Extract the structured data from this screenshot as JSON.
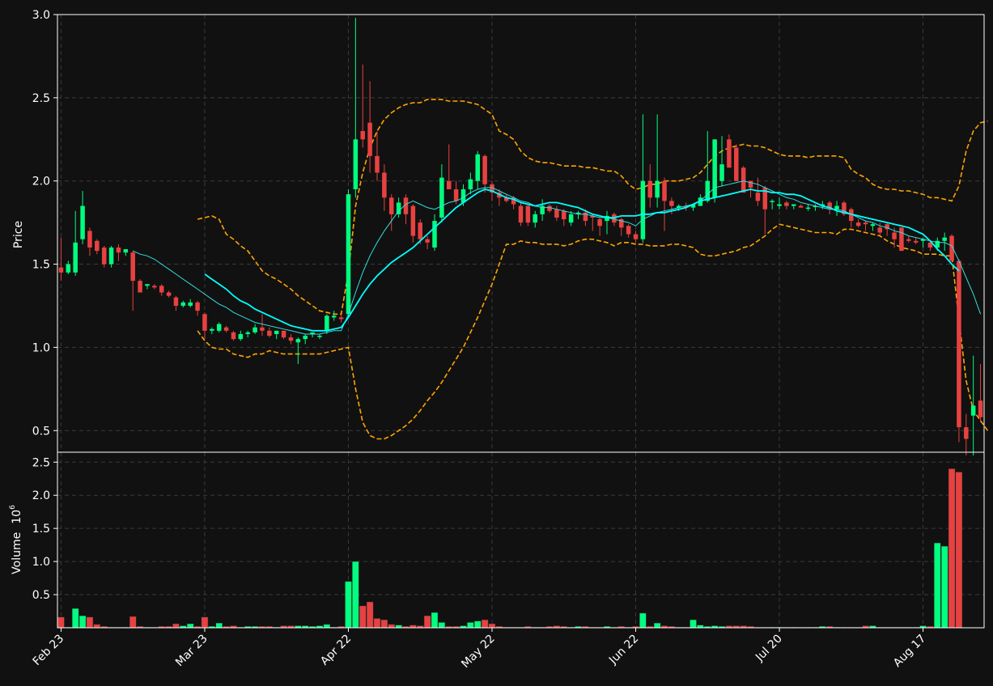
{
  "chart_data": [
    {
      "type": "candlestick",
      "panel": "price",
      "ylabel": "Price",
      "ylim": [
        0.37,
        3.0
      ],
      "yticks": [
        "0.5",
        "1.0",
        "1.5",
        "2.0",
        "2.5",
        "3.0"
      ],
      "grid": true,
      "x": [
        "Feb 23",
        "Feb 24",
        "Feb 25",
        "Feb 26",
        "Feb 27",
        "Feb 28",
        "Mar 1",
        "Mar 2",
        "Mar 3",
        "Mar 4",
        "Mar 5",
        "Mar 6",
        "Mar 7",
        "Mar 8",
        "Mar 9",
        "Mar 10",
        "Mar 11",
        "Mar 12",
        "Mar 13",
        "Mar 14",
        "Mar 23",
        "Mar 24",
        "Mar 25",
        "Mar 26",
        "Mar 27",
        "Mar 28",
        "Mar 29",
        "Mar 30",
        "Mar 31",
        "Apr 1",
        "Apr 2",
        "Apr 3",
        "Apr 4",
        "Apr 5",
        "Apr 6",
        "Apr 7",
        "Apr 8",
        "Apr 9",
        "Apr 10",
        "Apr 11",
        "Apr 22",
        "Apr 23",
        "Apr 24",
        "Apr 25",
        "Apr 26",
        "Apr 27",
        "Apr 28",
        "Apr 29",
        "Apr 30",
        "May 1",
        "May 2",
        "May 3",
        "May 4",
        "May 5",
        "May 6",
        "May 7",
        "May 8",
        "May 9",
        "May 10",
        "May 11",
        "May 22",
        "May 23",
        "May 24",
        "May 25",
        "May 26",
        "May 27",
        "May 28",
        "May 29",
        "May 30",
        "May 31",
        "Jun 1",
        "Jun 2",
        "Jun 3",
        "Jun 4",
        "Jun 5",
        "Jun 6",
        "Jun 7",
        "Jun 8",
        "Jun 9",
        "Jun 10",
        "Jun 22",
        "Jun 23",
        "Jun 24",
        "Jun 25",
        "Jun 26",
        "Jun 27",
        "Jun 28",
        "Jun 29",
        "Jun 30",
        "Jul 1",
        "Jul 2",
        "Jul 3",
        "Jul 4",
        "Jul 5",
        "Jul 6",
        "Jul 7",
        "Jul 8",
        "Jul 9",
        "Jul 10",
        "Jul 11",
        "Jul 20",
        "Jul 21",
        "Jul 22",
        "Jul 23",
        "Jul 24",
        "Jul 25",
        "Jul 26",
        "Jul 27",
        "Jul 28",
        "Jul 29",
        "Jul 30",
        "Jul 31",
        "Aug 1",
        "Aug 2",
        "Aug 3",
        "Aug 4",
        "Aug 5",
        "Aug 6",
        "Aug 7",
        "Aug 8",
        "Aug 17",
        "Aug 18",
        "Aug 19",
        "Aug 20",
        "Aug 21"
      ],
      "xticks": [
        {
          "index": 0,
          "label": "Feb 23"
        },
        {
          "index": 20,
          "label": "Mar 23"
        },
        {
          "index": 40,
          "label": "Apr 22"
        },
        {
          "index": 60,
          "label": "May 22"
        },
        {
          "index": 80,
          "label": "Jun 22"
        },
        {
          "index": 100,
          "label": "Jul 20"
        },
        {
          "index": 120,
          "label": "Aug 17"
        }
      ],
      "open": [
        1.48,
        1.45,
        1.45,
        1.65,
        1.7,
        1.64,
        1.6,
        1.5,
        1.6,
        1.57,
        1.57,
        1.4,
        1.37,
        1.37,
        1.37,
        1.33,
        1.3,
        1.25,
        1.25,
        1.27,
        1.2,
        1.1,
        1.1,
        1.12,
        1.09,
        1.05,
        1.08,
        1.09,
        1.12,
        1.1,
        1.08,
        1.1,
        1.06,
        1.03,
        1.05,
        1.08,
        1.07,
        1.1,
        1.18,
        1.18,
        1.2,
        1.95,
        2.3,
        2.35,
        2.15,
        2.05,
        1.9,
        1.8,
        1.9,
        1.85,
        1.75,
        1.65,
        1.6,
        1.78,
        2.0,
        1.95,
        1.87,
        1.95,
        2.0,
        2.15,
        1.98,
        1.93,
        1.9,
        1.9,
        1.85,
        1.85,
        1.75,
        1.8,
        1.85,
        1.83,
        1.82,
        1.75,
        1.8,
        1.81,
        1.79,
        1.77,
        1.76,
        1.8,
        1.77,
        1.73,
        1.68,
        1.65,
        2.0,
        1.9,
        2.0,
        1.88,
        1.84,
        1.85,
        1.84,
        1.85,
        1.88,
        1.9,
        2.0,
        2.25,
        2.2,
        2.08,
        2.0,
        1.93,
        1.96,
        1.88,
        1.85,
        1.87,
        1.85,
        1.85,
        1.84,
        1.85,
        1.85,
        1.87,
        1.83,
        1.87,
        1.83,
        1.75,
        1.75,
        1.73,
        1.72,
        1.74,
        1.69,
        1.72,
        1.65,
        1.64,
        1.64,
        1.63,
        1.6,
        1.64,
        1.67,
        1.52,
        0.52,
        0.59,
        0.68
      ],
      "high": [
        1.66,
        1.52,
        1.82,
        1.94,
        1.72,
        1.65,
        1.61,
        1.61,
        1.62,
        1.59,
        1.58,
        1.41,
        1.38,
        1.38,
        1.38,
        1.34,
        1.31,
        1.28,
        1.29,
        1.28,
        1.21,
        1.12,
        1.15,
        1.13,
        1.1,
        1.1,
        1.1,
        1.14,
        1.2,
        1.12,
        1.1,
        1.1,
        1.08,
        1.06,
        1.08,
        1.09,
        1.08,
        1.2,
        1.22,
        1.2,
        1.95,
        2.98,
        2.7,
        2.6,
        2.3,
        2.1,
        1.92,
        1.9,
        1.92,
        1.86,
        1.77,
        1.67,
        1.8,
        2.1,
        2.22,
        2.0,
        1.98,
        2.05,
        2.18,
        2.16,
        2.0,
        1.95,
        1.92,
        1.91,
        1.87,
        1.86,
        1.82,
        1.89,
        1.86,
        1.85,
        1.83,
        1.82,
        1.82,
        1.83,
        1.8,
        1.78,
        1.82,
        1.81,
        1.78,
        1.74,
        1.7,
        2.4,
        2.1,
        2.4,
        2.02,
        1.9,
        1.86,
        1.87,
        1.86,
        1.92,
        2.3,
        2.05,
        2.27,
        2.28,
        2.22,
        2.09,
        2.0,
        2.02,
        1.97,
        1.89,
        1.9,
        1.88,
        1.86,
        1.86,
        1.86,
        1.86,
        1.88,
        1.88,
        1.88,
        1.88,
        1.84,
        1.77,
        1.76,
        1.75,
        1.75,
        1.75,
        1.72,
        1.72,
        1.67,
        1.66,
        1.66,
        1.64,
        1.66,
        1.69,
        1.68,
        1.53,
        0.6,
        0.95,
        0.9
      ],
      "low": [
        1.4,
        1.44,
        1.43,
        1.62,
        1.55,
        1.56,
        1.48,
        1.48,
        1.52,
        1.55,
        1.22,
        1.34,
        1.35,
        1.35,
        1.31,
        1.3,
        1.22,
        1.24,
        1.24,
        1.19,
        1.05,
        1.08,
        1.09,
        1.09,
        1.04,
        1.04,
        1.06,
        1.08,
        1.07,
        1.06,
        1.05,
        1.05,
        1.02,
        0.9,
        1.02,
        1.06,
        1.05,
        1.08,
        1.16,
        1.15,
        1.18,
        1.9,
        2.2,
        2.05,
        2.0,
        1.82,
        1.7,
        1.78,
        1.74,
        1.63,
        1.62,
        1.59,
        1.58,
        1.75,
        1.95,
        1.86,
        1.85,
        1.92,
        1.95,
        1.93,
        1.88,
        1.85,
        1.87,
        1.83,
        1.73,
        1.73,
        1.72,
        1.76,
        1.81,
        1.76,
        1.73,
        1.73,
        1.77,
        1.73,
        1.7,
        1.67,
        1.68,
        1.73,
        1.67,
        1.66,
        1.63,
        1.63,
        1.84,
        1.84,
        1.7,
        1.8,
        1.82,
        1.82,
        1.82,
        1.85,
        1.87,
        1.87,
        1.97,
        2.15,
        2.08,
        1.97,
        1.9,
        1.85,
        1.68,
        1.83,
        1.83,
        1.83,
        1.83,
        1.84,
        1.82,
        1.82,
        1.83,
        1.8,
        1.79,
        1.79,
        1.72,
        1.72,
        1.7,
        1.7,
        1.67,
        1.67,
        1.6,
        1.6,
        1.63,
        1.62,
        1.6,
        1.58,
        1.58,
        1.58,
        1.6,
        0.43,
        0.35,
        0.35,
        0.55
      ],
      "close": [
        1.45,
        1.5,
        1.63,
        1.85,
        1.6,
        1.58,
        1.5,
        1.6,
        1.57,
        1.59,
        1.4,
        1.33,
        1.38,
        1.36,
        1.33,
        1.31,
        1.25,
        1.27,
        1.27,
        1.22,
        1.1,
        1.11,
        1.14,
        1.1,
        1.05,
        1.08,
        1.09,
        1.12,
        1.1,
        1.07,
        1.1,
        1.06,
        1.04,
        1.05,
        1.07,
        1.09,
        1.07,
        1.19,
        1.19,
        1.17,
        1.92,
        2.25,
        2.25,
        2.15,
        2.05,
        1.9,
        1.8,
        1.87,
        1.8,
        1.67,
        1.65,
        1.63,
        1.76,
        2.02,
        1.95,
        1.88,
        1.95,
        2.01,
        2.16,
        1.98,
        1.93,
        1.9,
        1.88,
        1.86,
        1.75,
        1.75,
        1.8,
        1.85,
        1.82,
        1.78,
        1.77,
        1.8,
        1.81,
        1.76,
        1.78,
        1.73,
        1.79,
        1.75,
        1.72,
        1.68,
        1.65,
        2.0,
        1.9,
        2.0,
        1.88,
        1.85,
        1.85,
        1.84,
        1.86,
        1.9,
        2.0,
        2.25,
        2.1,
        2.08,
        2.0,
        1.93,
        1.96,
        1.88,
        1.83,
        1.88,
        1.86,
        1.85,
        1.86,
        1.84,
        1.84,
        1.85,
        1.86,
        1.83,
        1.85,
        1.8,
        1.76,
        1.73,
        1.74,
        1.74,
        1.69,
        1.71,
        1.65,
        1.58,
        1.64,
        1.63,
        1.65,
        1.6,
        1.64,
        1.66,
        1.52,
        0.52,
        0.45,
        0.65,
        0.58
      ],
      "sma_short": [
        null,
        null,
        null,
        null,
        null,
        null,
        null,
        null,
        null,
        null,
        1.58,
        1.56,
        1.55,
        1.53,
        1.5,
        1.47,
        1.44,
        1.41,
        1.38,
        1.35,
        1.32,
        1.29,
        1.26,
        1.24,
        1.21,
        1.19,
        1.17,
        1.15,
        1.14,
        1.13,
        1.12,
        1.11,
        1.1,
        1.09,
        1.08,
        1.08,
        1.08,
        1.09,
        1.1,
        1.1,
        1.2,
        1.33,
        1.45,
        1.55,
        1.63,
        1.7,
        1.76,
        1.82,
        1.86,
        1.88,
        1.86,
        1.84,
        1.83,
        1.85,
        1.87,
        1.88,
        1.9,
        1.93,
        1.95,
        1.96,
        1.96,
        1.94,
        1.92,
        1.9,
        1.88,
        1.87,
        1.85,
        1.84,
        1.84,
        1.83,
        1.82,
        1.81,
        1.8,
        1.8,
        1.79,
        1.78,
        1.78,
        1.77,
        1.76,
        1.75,
        1.73,
        1.77,
        1.79,
        1.81,
        1.82,
        1.83,
        1.84,
        1.85,
        1.86,
        1.88,
        1.92,
        1.96,
        1.97,
        1.98,
        1.99,
        2.0,
        1.99,
        1.98,
        1.96,
        1.94,
        1.92,
        1.9,
        1.89,
        1.87,
        1.86,
        1.85,
        1.84,
        1.83,
        1.83,
        1.82,
        1.8,
        1.78,
        1.76,
        1.75,
        1.73,
        1.72,
        1.7,
        1.69,
        1.67,
        1.66,
        1.65,
        1.64,
        1.63,
        1.63,
        1.61,
        1.52,
        1.42,
        1.32,
        1.2
      ],
      "sma_long": [
        null,
        null,
        null,
        null,
        null,
        null,
        null,
        null,
        null,
        null,
        null,
        null,
        null,
        null,
        null,
        null,
        null,
        null,
        null,
        null,
        1.44,
        1.41,
        1.38,
        1.35,
        1.31,
        1.28,
        1.26,
        1.23,
        1.21,
        1.19,
        1.17,
        1.15,
        1.13,
        1.12,
        1.11,
        1.1,
        1.1,
        1.1,
        1.11,
        1.12,
        1.18,
        1.25,
        1.32,
        1.38,
        1.43,
        1.47,
        1.51,
        1.54,
        1.57,
        1.6,
        1.64,
        1.68,
        1.72,
        1.76,
        1.8,
        1.84,
        1.87,
        1.9,
        1.93,
        1.95,
        1.94,
        1.92,
        1.9,
        1.89,
        1.87,
        1.86,
        1.85,
        1.86,
        1.87,
        1.87,
        1.86,
        1.85,
        1.84,
        1.82,
        1.8,
        1.79,
        1.78,
        1.78,
        1.79,
        1.79,
        1.79,
        1.8,
        1.8,
        1.81,
        1.81,
        1.82,
        1.83,
        1.84,
        1.86,
        1.88,
        1.89,
        1.9,
        1.91,
        1.92,
        1.93,
        1.94,
        1.95,
        1.94,
        1.94,
        1.93,
        1.93,
        1.92,
        1.92,
        1.91,
        1.89,
        1.87,
        1.85,
        1.84,
        1.82,
        1.81,
        1.8,
        1.79,
        1.78,
        1.77,
        1.76,
        1.75,
        1.74,
        1.73,
        1.72,
        1.7,
        1.68,
        1.64,
        1.59,
        1.55,
        1.5,
        1.46
      ],
      "band_upper": [
        null,
        null,
        null,
        null,
        null,
        null,
        null,
        null,
        null,
        null,
        null,
        null,
        null,
        null,
        null,
        null,
        null,
        null,
        null,
        1.77,
        1.78,
        1.79,
        1.77,
        1.68,
        1.65,
        1.61,
        1.58,
        1.52,
        1.46,
        1.43,
        1.41,
        1.38,
        1.35,
        1.31,
        1.28,
        1.25,
        1.22,
        1.21,
        1.2,
        1.2,
        1.45,
        1.85,
        2.05,
        2.2,
        2.3,
        2.37,
        2.41,
        2.44,
        2.46,
        2.47,
        2.47,
        2.49,
        2.49,
        2.49,
        2.48,
        2.48,
        2.48,
        2.47,
        2.46,
        2.43,
        2.4,
        2.3,
        2.28,
        2.25,
        2.18,
        2.14,
        2.12,
        2.11,
        2.11,
        2.1,
        2.09,
        2.09,
        2.09,
        2.08,
        2.08,
        2.07,
        2.06,
        2.06,
        2.03,
        1.98,
        1.95,
        1.96,
        1.98,
        1.98,
        2.0,
        2.0,
        2.0,
        2.01,
        2.02,
        2.05,
        2.1,
        2.15,
        2.18,
        2.2,
        2.21,
        2.22,
        2.21,
        2.21,
        2.2,
        2.18,
        2.16,
        2.15,
        2.15,
        2.15,
        2.14,
        2.15,
        2.15,
        2.15,
        2.15,
        2.14,
        2.07,
        2.04,
        2.02,
        1.98,
        1.96,
        1.95,
        1.95,
        1.94,
        1.94,
        1.93,
        1.92,
        1.9,
        1.9,
        1.89,
        1.88,
        1.97,
        2.18,
        2.3,
        2.35,
        2.36
      ],
      "band_lower": [
        null,
        null,
        null,
        null,
        null,
        null,
        null,
        null,
        null,
        null,
        null,
        null,
        null,
        null,
        null,
        null,
        null,
        null,
        null,
        1.1,
        1.04,
        1.0,
        0.99,
        0.99,
        0.96,
        0.95,
        0.94,
        0.96,
        0.96,
        0.98,
        0.97,
        0.96,
        0.96,
        0.96,
        0.96,
        0.96,
        0.96,
        0.97,
        0.98,
        0.99,
        1.0,
        0.75,
        0.55,
        0.47,
        0.45,
        0.45,
        0.47,
        0.5,
        0.53,
        0.57,
        0.62,
        0.68,
        0.73,
        0.79,
        0.86,
        0.93,
        1.0,
        1.09,
        1.18,
        1.28,
        1.38,
        1.5,
        1.62,
        1.62,
        1.64,
        1.63,
        1.63,
        1.62,
        1.62,
        1.62,
        1.61,
        1.62,
        1.64,
        1.65,
        1.65,
        1.64,
        1.63,
        1.61,
        1.63,
        1.63,
        1.62,
        1.62,
        1.61,
        1.61,
        1.61,
        1.62,
        1.62,
        1.61,
        1.6,
        1.56,
        1.55,
        1.55,
        1.56,
        1.57,
        1.58,
        1.6,
        1.61,
        1.64,
        1.67,
        1.71,
        1.74,
        1.73,
        1.72,
        1.71,
        1.7,
        1.69,
        1.69,
        1.69,
        1.68,
        1.71,
        1.71,
        1.7,
        1.69,
        1.68,
        1.67,
        1.64,
        1.62,
        1.6,
        1.59,
        1.58,
        1.56,
        1.56,
        1.56,
        1.55,
        1.55,
        1.17,
        0.8,
        0.62,
        0.56,
        0.5
      ]
    },
    {
      "type": "bar",
      "panel": "volume",
      "ylabel": "Volume",
      "ylabel_exponent": "10",
      "ylabel_exponent_power": "6",
      "unit_multiplier": 1000000,
      "ylim": [
        0,
        2.65
      ],
      "yticks": [
        "0.5",
        "1.0",
        "1.5",
        "2.0",
        "2.5"
      ],
      "values": [
        0.16,
        0.01,
        0.29,
        0.18,
        0.16,
        0.05,
        0.02,
        0.01,
        0.01,
        0.01,
        0.17,
        0.02,
        0.01,
        0.01,
        0.02,
        0.02,
        0.06,
        0.03,
        0.06,
        0.02,
        0.16,
        0.02,
        0.07,
        0.02,
        0.03,
        0.01,
        0.02,
        0.02,
        0.02,
        0.02,
        0.01,
        0.03,
        0.03,
        0.03,
        0.03,
        0.02,
        0.03,
        0.05,
        0.01,
        0.02,
        0.7,
        1.0,
        0.33,
        0.39,
        0.14,
        0.12,
        0.05,
        0.04,
        0.02,
        0.04,
        0.03,
        0.18,
        0.23,
        0.08,
        0.02,
        0.02,
        0.03,
        0.08,
        0.1,
        0.12,
        0.06,
        0.02,
        0.01,
        0.01,
        0.01,
        0.02,
        0.01,
        0.01,
        0.02,
        0.03,
        0.02,
        0.01,
        0.02,
        0.02,
        0.01,
        0.01,
        0.02,
        0.01,
        0.02,
        0.01,
        0.02,
        0.22,
        0.02,
        0.07,
        0.03,
        0.02,
        0.01,
        0.01,
        0.12,
        0.04,
        0.02,
        0.03,
        0.02,
        0.03,
        0.03,
        0.03,
        0.02,
        0.01,
        0.01,
        0.01,
        0.01,
        0.01,
        0.01,
        0.01,
        0.01,
        0.01,
        0.02,
        0.02,
        0.01,
        0.01,
        0.01,
        0.01,
        0.03,
        0.03,
        0.01,
        0.01,
        0.01,
        0.01,
        0.01,
        0.01,
        0.03,
        0.02,
        1.28,
        1.23,
        2.4,
        2.35
      ]
    }
  ],
  "colors": {
    "background": "#111111",
    "axes_edge": "#ffffff",
    "grid": "#3a3a3a",
    "up": "#00ff7f",
    "down": "#e84141",
    "sma_short": "#33dfdf",
    "sma_long": "#00ffff",
    "band": "#ffa500",
    "text": "#ffffff"
  }
}
